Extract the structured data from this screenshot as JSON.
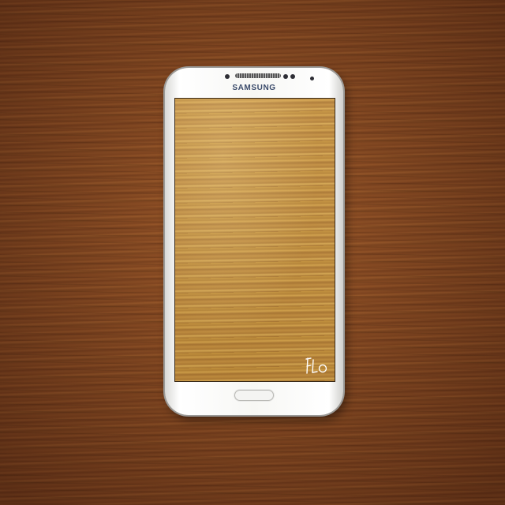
{
  "phone": {
    "brand": "SAMSUNG",
    "signature": "FLO"
  },
  "colors": {
    "table_wood": "#7c4320",
    "screen_wood": "#c8953e",
    "phone_body": "#f7f7f4"
  }
}
